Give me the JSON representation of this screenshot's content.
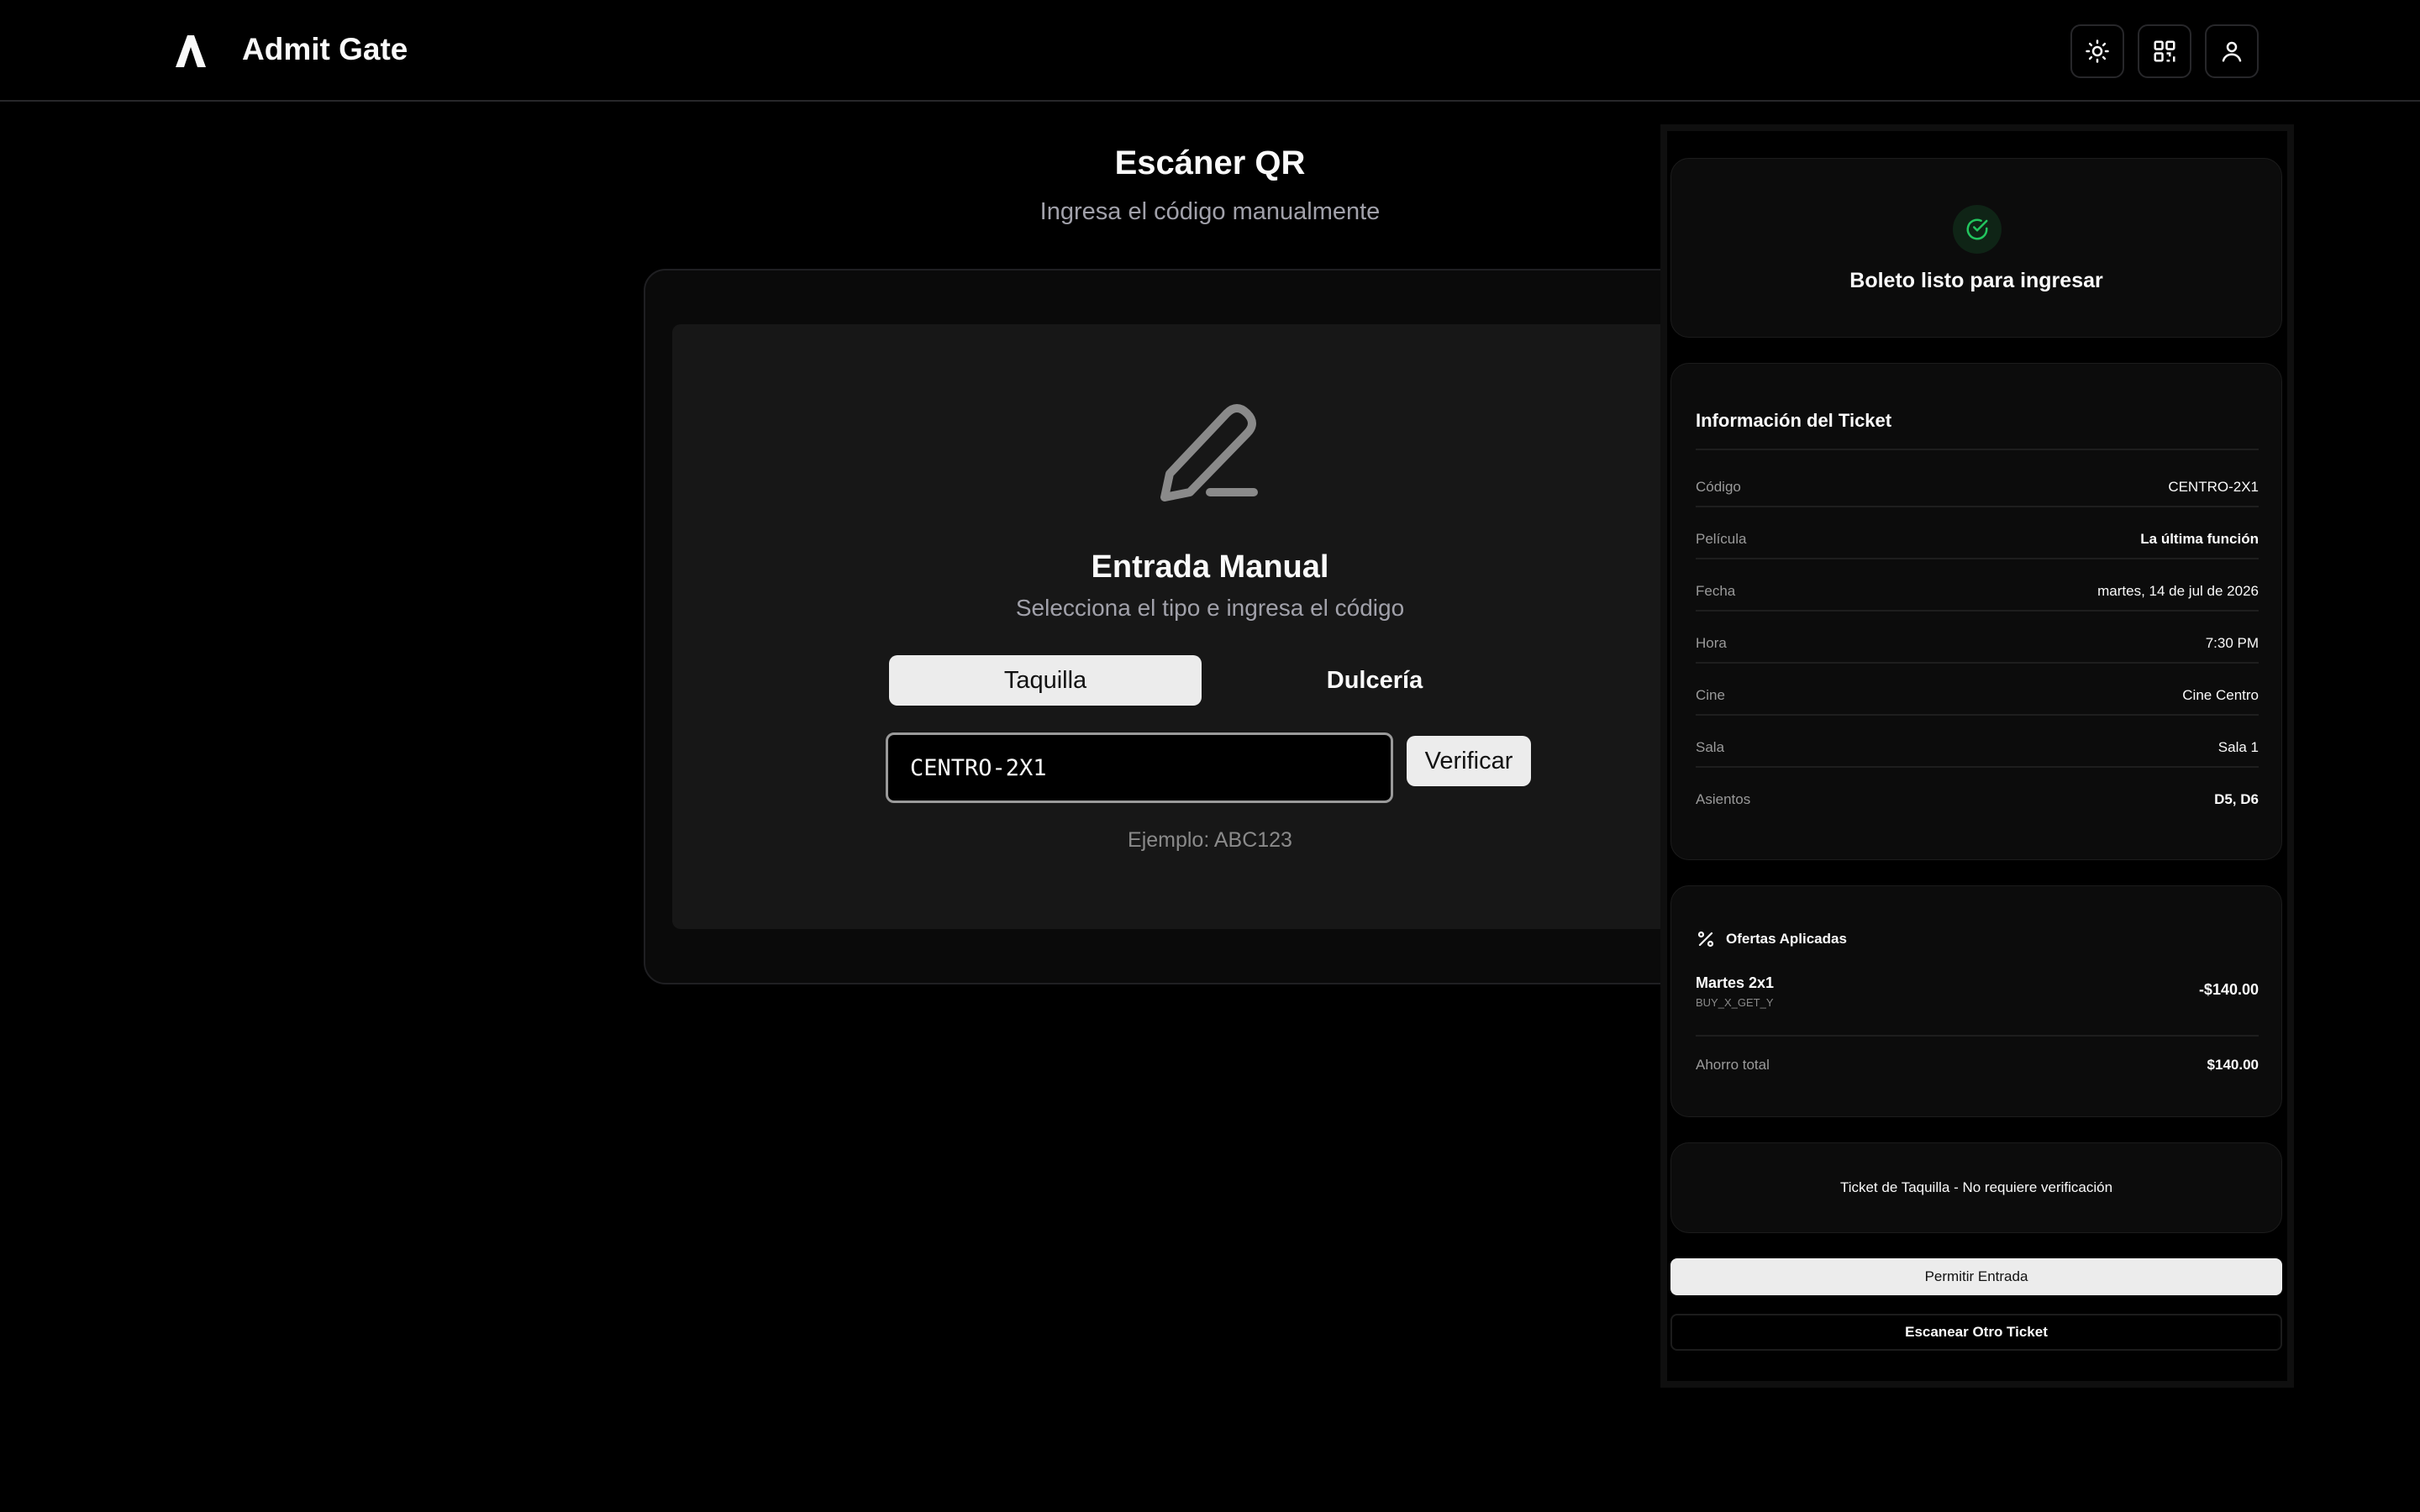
{
  "header": {
    "brand": "Admit Gate",
    "logo_icon": "logo-mark-icon",
    "buttons": [
      {
        "name": "theme-toggle-button",
        "icon": "sun-icon"
      },
      {
        "name": "qr-scanner-button",
        "icon": "qr-code-icon"
      },
      {
        "name": "user-profile-button",
        "icon": "user-icon"
      }
    ]
  },
  "page": {
    "title": "Escáner QR",
    "subtitle": "Ingresa el código manualmente"
  },
  "manual": {
    "icon": "pen-icon",
    "title": "Entrada Manual",
    "subtitle": "Selecciona el tipo e ingresa el código",
    "tabs": [
      {
        "label": "Taquilla",
        "active": true
      },
      {
        "label": "Dulcería",
        "active": false
      }
    ],
    "code_value": "CENTRO-2X1",
    "verify_label": "Verificar",
    "example": "Ejemplo: ABC123"
  },
  "result": {
    "status_icon": "check-circle-icon",
    "status_color": "#22c55e",
    "status_text": "Boleto listo para ingresar",
    "info_title": "Información del Ticket",
    "info_rows": [
      {
        "label": "Código",
        "value": "CENTRO-2X1",
        "bold": false
      },
      {
        "label": "Película",
        "value": "La última función",
        "bold": true
      },
      {
        "label": "Fecha",
        "value": "martes, 14 de jul de 2026",
        "bold": false
      },
      {
        "label": "Hora",
        "value": "7:30 PM",
        "bold": false
      },
      {
        "label": "Cine",
        "value": "Cine Centro",
        "bold": false
      },
      {
        "label": "Sala",
        "value": "Sala 1",
        "bold": false
      },
      {
        "label": "Asientos",
        "value": "D5, D6",
        "bold": true
      }
    ],
    "offers": {
      "icon": "percent-icon",
      "title": "Ofertas Aplicadas",
      "items": [
        {
          "name": "Martes 2x1",
          "code": "BUY_X_GET_Y",
          "amount": "-$140.00"
        }
      ],
      "saving_label": "Ahorro total",
      "saving_value": "$140.00"
    },
    "note": "Ticket de Taquilla - No requiere verificación",
    "allow_label": "Permitir Entrada",
    "scan_label": "Escanear Otro Ticket"
  }
}
